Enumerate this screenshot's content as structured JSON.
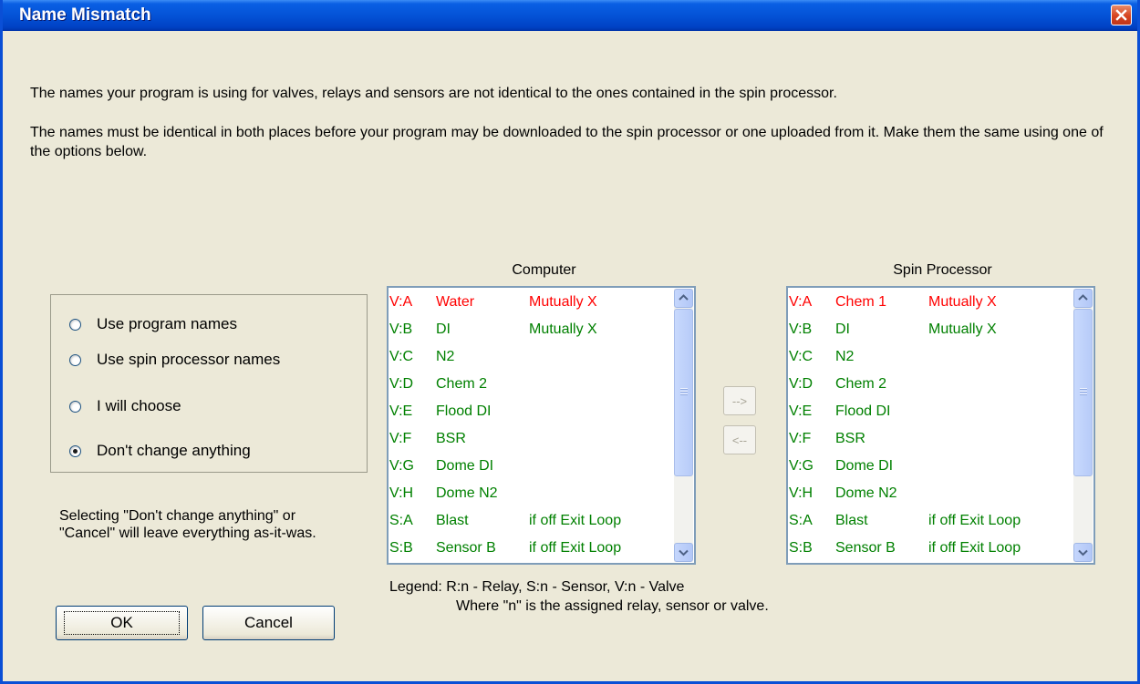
{
  "window": {
    "title": "Name Mismatch"
  },
  "message": {
    "line1": "The names your program is using for valves, relays and sensors are not identical to the ones contained in the spin processor.",
    "line2": "The names must be identical in both places before your program may be downloaded to the spin processor or one uploaded from it. Make them the same using one of the options below."
  },
  "options": [
    {
      "label": "Use program names",
      "checked": false
    },
    {
      "label": "Use spin processor names",
      "checked": false
    },
    {
      "label": "I will choose",
      "checked": false
    },
    {
      "label": "Don't change anything",
      "checked": true
    }
  ],
  "note": "Selecting \"Don't change anything\" or \"Cancel\" will leave everything as-it-was.",
  "buttons": {
    "ok": "OK",
    "cancel": "Cancel",
    "copy_right": "-->",
    "copy_left": "<--"
  },
  "computer": {
    "title": "Computer",
    "rows": [
      {
        "code": "V:A",
        "name": "Water",
        "extra": "Mutually X",
        "color": "red"
      },
      {
        "code": "V:B",
        "name": "DI",
        "extra": "Mutually X",
        "color": "green"
      },
      {
        "code": "V:C",
        "name": "N2",
        "extra": "",
        "color": "green"
      },
      {
        "code": "V:D",
        "name": "Chem 2",
        "extra": "",
        "color": "green"
      },
      {
        "code": "V:E",
        "name": "Flood DI",
        "extra": "",
        "color": "green"
      },
      {
        "code": "V:F",
        "name": "BSR",
        "extra": "",
        "color": "green"
      },
      {
        "code": "V:G",
        "name": "Dome DI",
        "extra": "",
        "color": "green"
      },
      {
        "code": "V:H",
        "name": "Dome N2",
        "extra": "",
        "color": "green"
      },
      {
        "code": "S:A",
        "name": "Blast",
        "extra": "if off  Exit Loop",
        "color": "green"
      },
      {
        "code": "S:B",
        "name": "Sensor B",
        "extra": "if off  Exit Loop",
        "color": "green"
      }
    ]
  },
  "spin": {
    "title": "Spin Processor",
    "rows": [
      {
        "code": "V:A",
        "name": "Chem 1",
        "extra": "Mutually X",
        "color": "red"
      },
      {
        "code": "V:B",
        "name": "DI",
        "extra": "Mutually X",
        "color": "green"
      },
      {
        "code": "V:C",
        "name": "N2",
        "extra": "",
        "color": "green"
      },
      {
        "code": "V:D",
        "name": "Chem 2",
        "extra": "",
        "color": "green"
      },
      {
        "code": "V:E",
        "name": "Flood DI",
        "extra": "",
        "color": "green"
      },
      {
        "code": "V:F",
        "name": "BSR",
        "extra": "",
        "color": "green"
      },
      {
        "code": "V:G",
        "name": "Dome DI",
        "extra": "",
        "color": "green"
      },
      {
        "code": "V:H",
        "name": "Dome N2",
        "extra": "",
        "color": "green"
      },
      {
        "code": "S:A",
        "name": "Blast",
        "extra": "if off  Exit Loop",
        "color": "green"
      },
      {
        "code": "S:B",
        "name": "Sensor B",
        "extra": "if off  Exit Loop",
        "color": "green"
      }
    ]
  },
  "legend": {
    "line1": "Legend: R:n - Relay, S:n - Sensor, V:n - Valve",
    "line2": "Where \"n\" is the assigned relay, sensor or valve."
  },
  "colors": {
    "title_bar": "#0453d7",
    "mismatch": "#ff0000",
    "match": "#008000",
    "dialog_bg": "#ece9d8"
  }
}
